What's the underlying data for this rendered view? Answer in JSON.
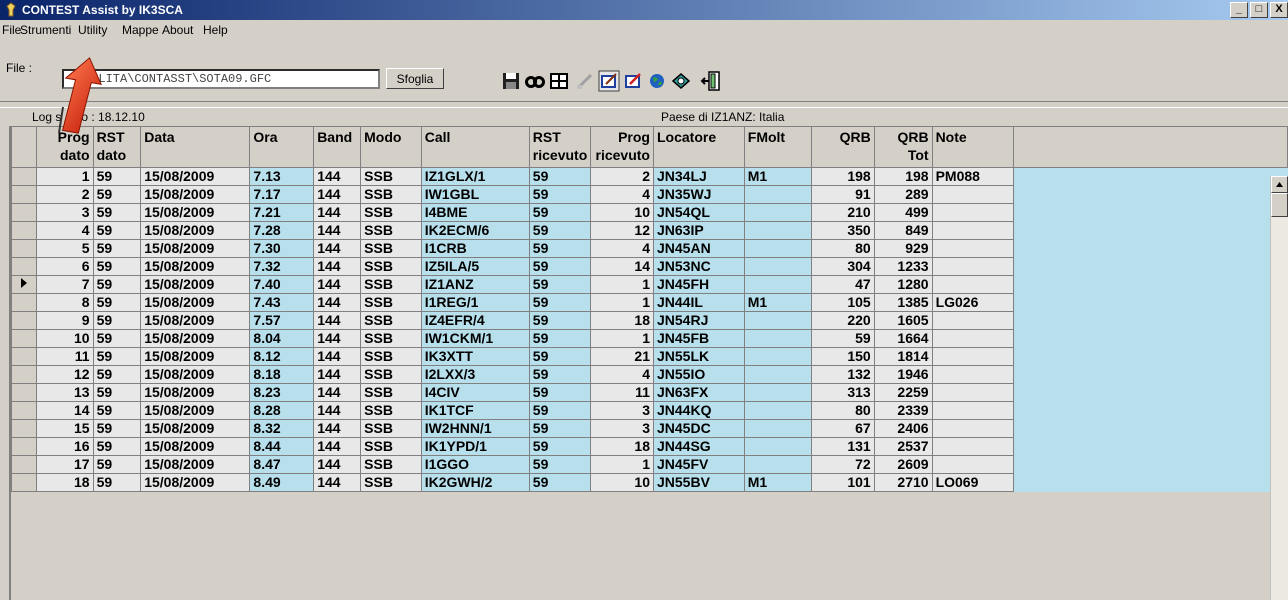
{
  "window": {
    "title": "CONTEST Assist by IK3SCA",
    "buttons": [
      "_",
      "□",
      "X"
    ]
  },
  "menu": [
    "File",
    "Strumenti",
    "Utility",
    "Mappe",
    "About",
    "Help"
  ],
  "file": {
    "label": "File :",
    "value": "TILITA\\CONTASST\\SOTA09.GFC",
    "browse_label": "Sfoglia"
  },
  "toolbar": [
    "save-icon",
    "find-icon",
    "grid-icon",
    "pencil-disabled-icon",
    "edit-icon",
    "edit-red-icon",
    "globe-icon",
    "map-icon",
    "exit-icon"
  ],
  "status": {
    "log_saved": "Log s",
    "log_saved_tail": "o : 18.12.10",
    "country": "Paese di IZ1ANZ: Italia"
  },
  "columns": [
    "Prog dato",
    "RST dato",
    "Data",
    "Ora",
    "Band",
    "Modo",
    "Call",
    "RST ricevuto",
    "Prog ricevuto",
    "Locatore",
    "FMolt",
    "QRB",
    "QRB Tot",
    "Note"
  ],
  "selected_row_index": 6,
  "rows": [
    [
      "1",
      "59",
      "15/08/2009",
      "7.13",
      "144",
      "SSB",
      "IZ1GLX/1",
      "59",
      "2",
      "JN34LJ",
      "M1",
      "198",
      "198",
      "PM088"
    ],
    [
      "2",
      "59",
      "15/08/2009",
      "7.17",
      "144",
      "SSB",
      "IW1GBL",
      "59",
      "4",
      "JN35WJ",
      "",
      "91",
      "289",
      ""
    ],
    [
      "3",
      "59",
      "15/08/2009",
      "7.21",
      "144",
      "SSB",
      "I4BME",
      "59",
      "10",
      "JN54QL",
      "",
      "210",
      "499",
      ""
    ],
    [
      "4",
      "59",
      "15/08/2009",
      "7.28",
      "144",
      "SSB",
      "IK2ECM/6",
      "59",
      "12",
      "JN63IP",
      "",
      "350",
      "849",
      ""
    ],
    [
      "5",
      "59",
      "15/08/2009",
      "7.30",
      "144",
      "SSB",
      "I1CRB",
      "59",
      "4",
      "JN45AN",
      "",
      "80",
      "929",
      ""
    ],
    [
      "6",
      "59",
      "15/08/2009",
      "7.32",
      "144",
      "SSB",
      "IZ5ILA/5",
      "59",
      "14",
      "JN53NC",
      "",
      "304",
      "1233",
      ""
    ],
    [
      "7",
      "59",
      "15/08/2009",
      "7.40",
      "144",
      "SSB",
      "IZ1ANZ",
      "59",
      "1",
      "JN45FH",
      "",
      "47",
      "1280",
      ""
    ],
    [
      "8",
      "59",
      "15/08/2009",
      "7.43",
      "144",
      "SSB",
      "I1REG/1",
      "59",
      "1",
      "JN44IL",
      "M1",
      "105",
      "1385",
      "LG026"
    ],
    [
      "9",
      "59",
      "15/08/2009",
      "7.57",
      "144",
      "SSB",
      "IZ4EFR/4",
      "59",
      "18",
      "JN54RJ",
      "",
      "220",
      "1605",
      ""
    ],
    [
      "10",
      "59",
      "15/08/2009",
      "8.04",
      "144",
      "SSB",
      "IW1CKM/1",
      "59",
      "1",
      "JN45FB",
      "",
      "59",
      "1664",
      ""
    ],
    [
      "11",
      "59",
      "15/08/2009",
      "8.12",
      "144",
      "SSB",
      "IK3XTT",
      "59",
      "21",
      "JN55LK",
      "",
      "150",
      "1814",
      ""
    ],
    [
      "12",
      "59",
      "15/08/2009",
      "8.18",
      "144",
      "SSB",
      "I2LXX/3",
      "59",
      "4",
      "JN55IO",
      "",
      "132",
      "1946",
      ""
    ],
    [
      "13",
      "59",
      "15/08/2009",
      "8.23",
      "144",
      "SSB",
      "I4CIV",
      "59",
      "11",
      "JN63FX",
      "",
      "313",
      "2259",
      ""
    ],
    [
      "14",
      "59",
      "15/08/2009",
      "8.28",
      "144",
      "SSB",
      "IK1TCF",
      "59",
      "3",
      "JN44KQ",
      "",
      "80",
      "2339",
      ""
    ],
    [
      "15",
      "59",
      "15/08/2009",
      "8.32",
      "144",
      "SSB",
      "IW2HNN/1",
      "59",
      "3",
      "JN45DC",
      "",
      "67",
      "2406",
      ""
    ],
    [
      "16",
      "59",
      "15/08/2009",
      "8.44",
      "144",
      "SSB",
      "IK1YPD/1",
      "59",
      "18",
      "JN44SG",
      "",
      "131",
      "2537",
      ""
    ],
    [
      "17",
      "59",
      "15/08/2009",
      "8.47",
      "144",
      "SSB",
      "I1GGO",
      "59",
      "1",
      "JN45FV",
      "",
      "72",
      "2609",
      ""
    ],
    [
      "18",
      "59",
      "15/08/2009",
      "8.49",
      "144",
      "SSB",
      "IK2GWH/2",
      "59",
      "10",
      "JN55BV",
      "M1",
      "101",
      "2710",
      "LO069"
    ]
  ],
  "colors": {
    "title_start": "#0a246a",
    "title_end": "#a6caf0",
    "cell_blue": "#b8e0ec",
    "cell_gray": "#e8e8e8",
    "window_face": "#d4d0c8",
    "arrow_red": "#e8391e"
  }
}
